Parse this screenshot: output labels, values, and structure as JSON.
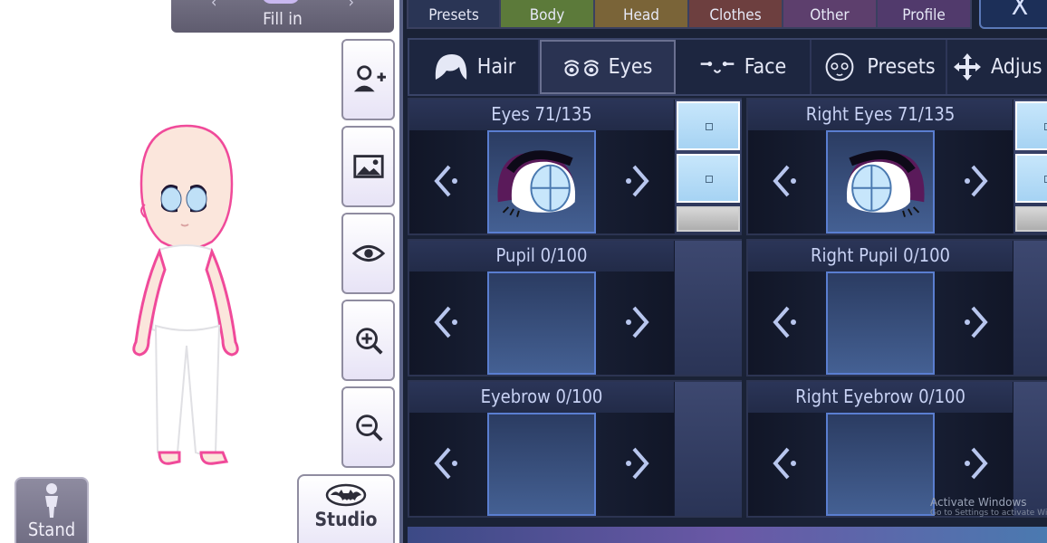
{
  "stage": {
    "fill_in": {
      "label": "Fill in",
      "left_arrow": "‹",
      "right_arrow": "›"
    },
    "side_buttons": [
      {
        "name": "add-character-button",
        "icon": "add-person-icon"
      },
      {
        "name": "background-button",
        "icon": "image-icon"
      },
      {
        "name": "toggle-visibility-button",
        "icon": "eye-icon"
      },
      {
        "name": "zoom-in-button",
        "icon": "zoom-in-icon"
      },
      {
        "name": "zoom-out-button",
        "icon": "zoom-out-icon"
      }
    ],
    "studio_label": "Studio",
    "stand_label": "Stand"
  },
  "top_tabs": [
    {
      "label": "Presets",
      "color": "#e6e8f6",
      "bg": "#2a3555"
    },
    {
      "label": "Body",
      "color": "#e4f2d6",
      "bg": "#5c7a3a"
    },
    {
      "label": "Head",
      "color": "#f6ead0",
      "bg": "#7a6438"
    },
    {
      "label": "Clothes",
      "color": "#f4e0e0",
      "bg": "#6d3f3f"
    },
    {
      "label": "Other",
      "color": "#f0e2f4",
      "bg": "#5d3f6d"
    },
    {
      "label": "Profile",
      "color": "#efe2f6",
      "bg": "#513a6c"
    }
  ],
  "close_label": "X",
  "sub_tabs": [
    {
      "label": "Hair",
      "icon": "hair-icon",
      "active": false
    },
    {
      "label": "Eyes",
      "icon": "eyes-icon",
      "active": true
    },
    {
      "label": "Face",
      "icon": "face-icon",
      "active": false
    },
    {
      "label": "Presets",
      "icon": "face-preset-icon",
      "active": false
    },
    {
      "label": "Adjus",
      "icon": "move-arrows-icon",
      "active": false
    }
  ],
  "cells": [
    {
      "title": "Eyes 71/135",
      "has_eye": true,
      "eye_side": "left",
      "swatches": true
    },
    {
      "title": "Right Eyes 71/135",
      "has_eye": true,
      "eye_side": "right",
      "swatches": true
    },
    {
      "title": "Pupil 0/100",
      "has_eye": false,
      "swatches": false
    },
    {
      "title": "Right Pupil 0/100",
      "has_eye": false,
      "swatches": false
    },
    {
      "title": "Eyebrow 0/100",
      "has_eye": false,
      "swatches": false
    },
    {
      "title": "Right Eyebrow 0/100",
      "has_eye": false,
      "swatches": false
    }
  ],
  "watermark": {
    "title": "Activate Windows",
    "subtitle": "Go to Settings to activate Windows."
  }
}
